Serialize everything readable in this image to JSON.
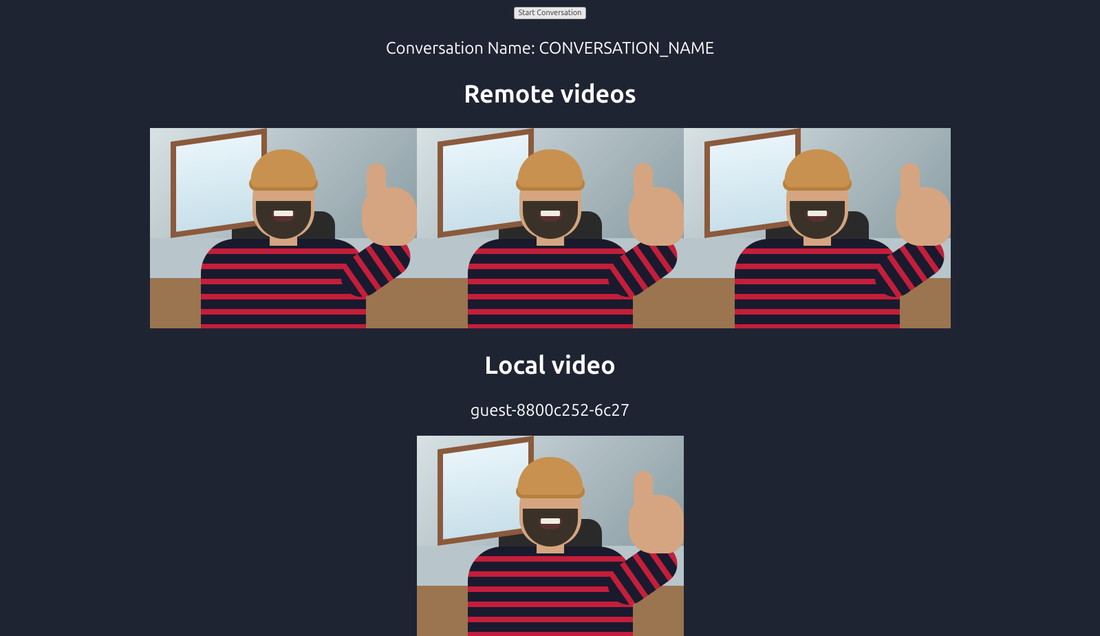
{
  "startButton": {
    "label": "Start Conversation"
  },
  "conversationLabel": "Conversation Name: CONVERSATION_NAME",
  "remoteSection": {
    "heading": "Remote videos",
    "count": 3
  },
  "localSection": {
    "heading": "Local video",
    "guestId": "guest-8800c252-6c27"
  }
}
